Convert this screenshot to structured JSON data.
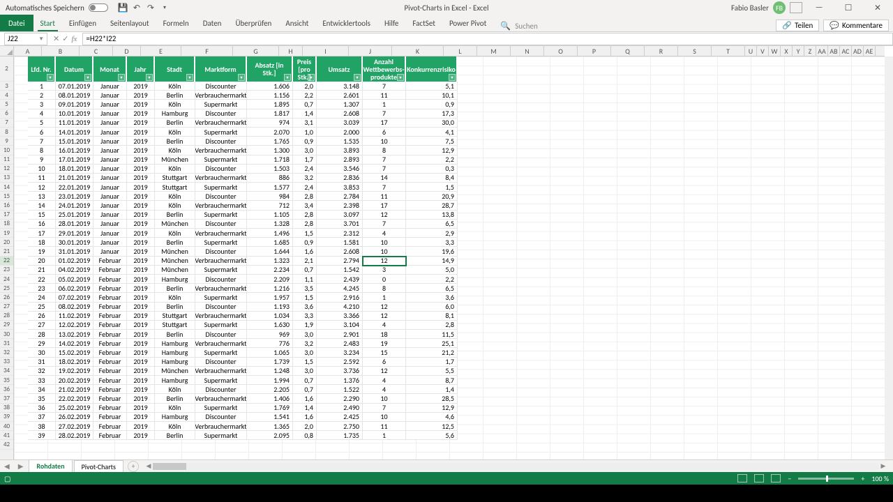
{
  "titlebar": {
    "autosave": "Automatisches Speichern",
    "doc": "Pivot-Charts in Excel  -  Excel",
    "user": "Fabio Basler",
    "user_initials": "FB"
  },
  "ribbon": {
    "file": "Datei",
    "tabs": [
      "Start",
      "Einfügen",
      "Seitenlayout",
      "Formeln",
      "Daten",
      "Überprüfen",
      "Ansicht",
      "Entwicklertools",
      "Hilfe",
      "FactSet",
      "Power Pivot"
    ],
    "search": "Suchen",
    "share": "Teilen",
    "comments": "Kommentare"
  },
  "fx": {
    "cell": "J22",
    "formula": "=H22*I22"
  },
  "columns": [
    "A",
    "B",
    "C",
    "D",
    "E",
    "F",
    "G",
    "H",
    "I",
    "J",
    "K",
    "L",
    "M",
    "N",
    "O",
    "P",
    "Q",
    "R",
    "S",
    "T",
    "U",
    "V",
    "W",
    "X",
    "Y",
    "Z",
    "AA",
    "AB",
    "AC",
    "AD",
    "AE"
  ],
  "narrow_start": 20,
  "headers": [
    "Lfd. Nr.",
    "Datum",
    "Monat",
    "Jahr",
    "Stadt",
    "Marktform",
    "Absatz [in Stk.]",
    "Preis [pro Stk.]",
    "Umsatz",
    "Anzahl Wettbewerbs-produkte",
    "Konkurrenzrisiko"
  ],
  "rows": [
    [
      "1",
      "07.01.2019",
      "Januar",
      "2019",
      "Köln",
      "Discounter",
      "1.606",
      "2,0",
      "3.148",
      "7",
      "5,1"
    ],
    [
      "2",
      "08.01.2019",
      "Januar",
      "2019",
      "Berlin",
      "Verbrauchermarkt",
      "1.156",
      "2,2",
      "2.601",
      "11",
      "10,1"
    ],
    [
      "3",
      "09.01.2019",
      "Januar",
      "2019",
      "Köln",
      "Supermarkt",
      "1.895",
      "0,7",
      "1.307",
      "1",
      "0,9"
    ],
    [
      "4",
      "10.01.2019",
      "Januar",
      "2019",
      "Hamburg",
      "Discounter",
      "1.817",
      "1,4",
      "2.608",
      "7",
      "17,3"
    ],
    [
      "5",
      "11.01.2019",
      "Januar",
      "2019",
      "Berlin",
      "Verbrauchermarkt",
      "974",
      "3,1",
      "3.039",
      "17",
      "30,0"
    ],
    [
      "6",
      "14.01.2019",
      "Januar",
      "2019",
      "Köln",
      "Supermarkt",
      "2.070",
      "1,0",
      "2.000",
      "6",
      "4,1"
    ],
    [
      "7",
      "15.01.2019",
      "Januar",
      "2019",
      "Berlin",
      "Discounter",
      "1.765",
      "0,9",
      "1.535",
      "10",
      "7,5"
    ],
    [
      "8",
      "16.01.2019",
      "Januar",
      "2019",
      "Köln",
      "Verbrauchermarkt",
      "1.300",
      "3,0",
      "3.893",
      "8",
      "12,9"
    ],
    [
      "9",
      "17.01.2019",
      "Januar",
      "2019",
      "München",
      "Supermarkt",
      "1.718",
      "1,7",
      "2.893",
      "7",
      "2,2"
    ],
    [
      "10",
      "18.01.2019",
      "Januar",
      "2019",
      "Köln",
      "Discounter",
      "1.503",
      "2,4",
      "3.546",
      "7",
      "0,3"
    ],
    [
      "11",
      "21.01.2019",
      "Januar",
      "2019",
      "Stuttgart",
      "Verbrauchermarkt",
      "886",
      "3,2",
      "2.836",
      "14",
      "8,4"
    ],
    [
      "12",
      "22.01.2019",
      "Januar",
      "2019",
      "Stuttgart",
      "Supermarkt",
      "1.577",
      "2,4",
      "3.853",
      "7",
      "1,5"
    ],
    [
      "13",
      "23.01.2019",
      "Januar",
      "2019",
      "Köln",
      "Discounter",
      "984",
      "2,8",
      "2.784",
      "11",
      "20,9"
    ],
    [
      "14",
      "24.01.2019",
      "Januar",
      "2019",
      "Köln",
      "Verbrauchermarkt",
      "712",
      "3,4",
      "2.398",
      "17",
      "28,7"
    ],
    [
      "15",
      "25.01.2019",
      "Januar",
      "2019",
      "Berlin",
      "Supermarkt",
      "1.105",
      "2,8",
      "3.097",
      "12",
      "13,8"
    ],
    [
      "16",
      "28.01.2019",
      "Januar",
      "2019",
      "München",
      "Discounter",
      "1.328",
      "2,8",
      "3.701",
      "7",
      "6,5"
    ],
    [
      "17",
      "29.01.2019",
      "Januar",
      "2019",
      "Köln",
      "Verbrauchermarkt",
      "1.496",
      "1,5",
      "2.312",
      "4",
      "2,9"
    ],
    [
      "18",
      "30.01.2019",
      "Januar",
      "2019",
      "Berlin",
      "Supermarkt",
      "1.685",
      "0,9",
      "1.581",
      "10",
      "3,3"
    ],
    [
      "19",
      "31.01.2019",
      "Januar",
      "2019",
      "München",
      "Discounter",
      "1.644",
      "1,6",
      "2.608",
      "10",
      "19,6"
    ],
    [
      "20",
      "01.02.2019",
      "Februar",
      "2019",
      "München",
      "Verbrauchermarkt",
      "1.323",
      "2,1",
      "2.794",
      "12",
      "14,9"
    ],
    [
      "21",
      "04.02.2019",
      "Februar",
      "2019",
      "München",
      "Supermarkt",
      "2.234",
      "0,7",
      "1.542",
      "3",
      "5,0"
    ],
    [
      "22",
      "05.02.2019",
      "Februar",
      "2019",
      "Hamburg",
      "Discounter",
      "2.209",
      "1,1",
      "2.439",
      "0",
      "2,2"
    ],
    [
      "23",
      "06.02.2019",
      "Februar",
      "2019",
      "Berlin",
      "Verbrauchermarkt",
      "1.216",
      "3,5",
      "4.245",
      "8",
      "6,5"
    ],
    [
      "24",
      "07.02.2019",
      "Februar",
      "2019",
      "Köln",
      "Supermarkt",
      "1.957",
      "1,5",
      "2.916",
      "1",
      "3,6"
    ],
    [
      "25",
      "08.02.2019",
      "Februar",
      "2019",
      "Berlin",
      "Discounter",
      "1.193",
      "3,6",
      "4.210",
      "12",
      "6,0"
    ],
    [
      "26",
      "11.02.2019",
      "Februar",
      "2019",
      "Stuttgart",
      "Verbrauchermarkt",
      "1.034",
      "3,3",
      "3.366",
      "12",
      "8,1"
    ],
    [
      "27",
      "12.02.2019",
      "Februar",
      "2019",
      "Stuttgart",
      "Supermarkt",
      "1.630",
      "1,9",
      "3.104",
      "4",
      "2,8"
    ],
    [
      "28",
      "13.02.2019",
      "Februar",
      "2019",
      "Berlin",
      "Discounter",
      "969",
      "3,0",
      "2.901",
      "18",
      "11,5"
    ],
    [
      "29",
      "14.02.2019",
      "Februar",
      "2019",
      "Hamburg",
      "Verbrauchermarkt",
      "776",
      "3,2",
      "2.483",
      "19",
      "25,1"
    ],
    [
      "30",
      "15.02.2019",
      "Februar",
      "2019",
      "Hamburg",
      "Supermarkt",
      "1.065",
      "3,0",
      "3.234",
      "15",
      "21,2"
    ],
    [
      "31",
      "18.02.2019",
      "Februar",
      "2019",
      "Hamburg",
      "Discounter",
      "1.739",
      "1,5",
      "2.592",
      "6",
      "1,7"
    ],
    [
      "32",
      "19.02.2019",
      "Februar",
      "2019",
      "München",
      "Verbrauchermarkt",
      "1.248",
      "3,0",
      "3.736",
      "12",
      "5,5"
    ],
    [
      "33",
      "20.02.2019",
      "Februar",
      "2019",
      "Hamburg",
      "Supermarkt",
      "1.994",
      "0,7",
      "1.376",
      "4",
      "8,7"
    ],
    [
      "34",
      "21.02.2019",
      "Februar",
      "2019",
      "Köln",
      "Discounter",
      "2.205",
      "0,7",
      "1.522",
      "4",
      "1,4"
    ],
    [
      "35",
      "22.02.2019",
      "Februar",
      "2019",
      "Berlin",
      "Verbrauchermarkt",
      "1.406",
      "1,6",
      "2.290",
      "10",
      "28,5"
    ],
    [
      "36",
      "25.02.2019",
      "Februar",
      "2019",
      "Köln",
      "Supermarkt",
      "1.769",
      "1,4",
      "2.490",
      "7",
      "12,9"
    ],
    [
      "37",
      "26.02.2019",
      "Februar",
      "2019",
      "Hamburg",
      "Discounter",
      "1.541",
      "1,6",
      "2.425",
      "10",
      "4,6"
    ],
    [
      "38",
      "27.02.2019",
      "Februar",
      "2019",
      "Köln",
      "Verbrauchermarkt",
      "1.365",
      "2,0",
      "2.750",
      "11",
      "12,5"
    ],
    [
      "39",
      "28.02.2019",
      "Februar",
      "2019",
      "Berlin",
      "Supermarkt",
      "2.095",
      "0,8",
      "1.735",
      "1",
      "5,6"
    ]
  ],
  "active_cell": {
    "col": "J",
    "row": 22,
    "data_row_index": 19
  },
  "sheet_tabs": {
    "active": "Rohdaten",
    "other": "Pivot-Charts"
  },
  "status": {
    "zoom": "100 %"
  }
}
